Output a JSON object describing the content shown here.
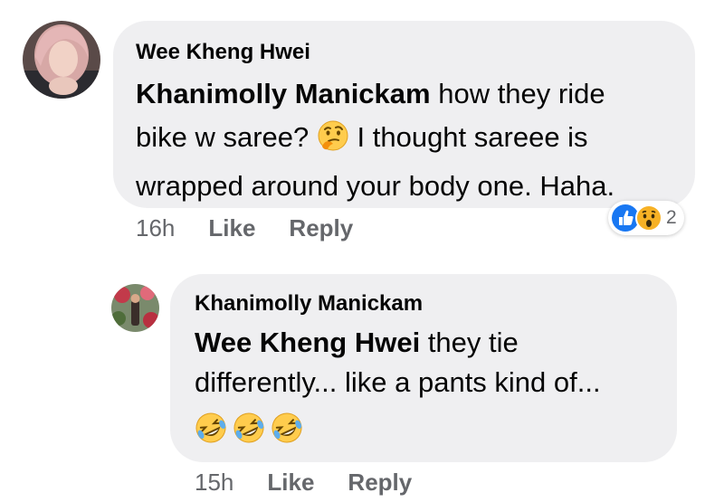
{
  "comment": {
    "author": "Wee Kheng Hwei",
    "mention": "Khanimolly Manickam",
    "text_line1_rest": " how they ride",
    "text_line2_before_emoji": "bike w saree? ",
    "text_line2_after_emoji": " I thought sareee is",
    "text_line3": "wrapped around your body one. Haha.",
    "inline_emoji": "thinking-face",
    "time": "16h",
    "like_label": "Like",
    "reply_label": "Reply",
    "reactions": {
      "types": [
        "like",
        "wow"
      ],
      "count": "2",
      "colors": {
        "like": "#1877f2",
        "wow": "#f7b125"
      }
    }
  },
  "reply": {
    "author": "Khanimolly Manickam",
    "mention": "Wee Kheng Hwei",
    "text_line1_rest": " they tie",
    "text_line2": "differently... like a pants kind of...",
    "emojis": [
      "rolling-on-floor-laughing",
      "rolling-on-floor-laughing",
      "rolling-on-floor-laughing"
    ],
    "time": "15h",
    "like_label": "Like",
    "reply_label": "Reply"
  },
  "colors": {
    "bubble": "#efeff1",
    "meta_text": "#65676b",
    "text": "#050505"
  }
}
